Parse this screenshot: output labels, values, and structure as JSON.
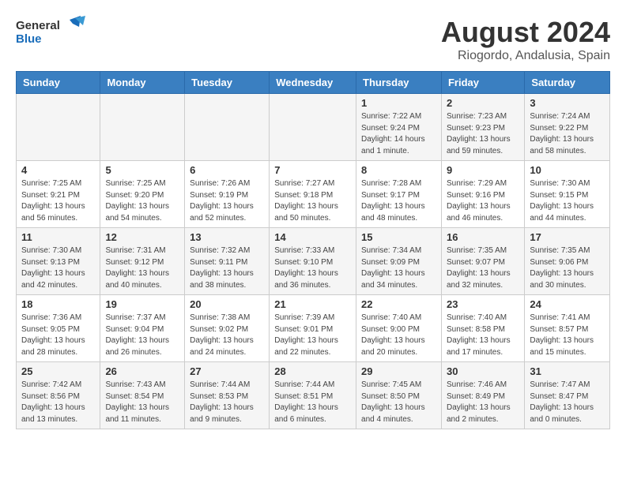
{
  "header": {
    "logo_general": "General",
    "logo_blue": "Blue",
    "title": "August 2024",
    "subtitle": "Riogordo, Andalusia, Spain"
  },
  "days_of_week": [
    "Sunday",
    "Monday",
    "Tuesday",
    "Wednesday",
    "Thursday",
    "Friday",
    "Saturday"
  ],
  "weeks": [
    [
      {
        "day": "",
        "info": ""
      },
      {
        "day": "",
        "info": ""
      },
      {
        "day": "",
        "info": ""
      },
      {
        "day": "",
        "info": ""
      },
      {
        "day": "1",
        "info": "Sunrise: 7:22 AM\nSunset: 9:24 PM\nDaylight: 14 hours\nand 1 minute."
      },
      {
        "day": "2",
        "info": "Sunrise: 7:23 AM\nSunset: 9:23 PM\nDaylight: 13 hours\nand 59 minutes."
      },
      {
        "day": "3",
        "info": "Sunrise: 7:24 AM\nSunset: 9:22 PM\nDaylight: 13 hours\nand 58 minutes."
      }
    ],
    [
      {
        "day": "4",
        "info": "Sunrise: 7:25 AM\nSunset: 9:21 PM\nDaylight: 13 hours\nand 56 minutes."
      },
      {
        "day": "5",
        "info": "Sunrise: 7:25 AM\nSunset: 9:20 PM\nDaylight: 13 hours\nand 54 minutes."
      },
      {
        "day": "6",
        "info": "Sunrise: 7:26 AM\nSunset: 9:19 PM\nDaylight: 13 hours\nand 52 minutes."
      },
      {
        "day": "7",
        "info": "Sunrise: 7:27 AM\nSunset: 9:18 PM\nDaylight: 13 hours\nand 50 minutes."
      },
      {
        "day": "8",
        "info": "Sunrise: 7:28 AM\nSunset: 9:17 PM\nDaylight: 13 hours\nand 48 minutes."
      },
      {
        "day": "9",
        "info": "Sunrise: 7:29 AM\nSunset: 9:16 PM\nDaylight: 13 hours\nand 46 minutes."
      },
      {
        "day": "10",
        "info": "Sunrise: 7:30 AM\nSunset: 9:15 PM\nDaylight: 13 hours\nand 44 minutes."
      }
    ],
    [
      {
        "day": "11",
        "info": "Sunrise: 7:30 AM\nSunset: 9:13 PM\nDaylight: 13 hours\nand 42 minutes."
      },
      {
        "day": "12",
        "info": "Sunrise: 7:31 AM\nSunset: 9:12 PM\nDaylight: 13 hours\nand 40 minutes."
      },
      {
        "day": "13",
        "info": "Sunrise: 7:32 AM\nSunset: 9:11 PM\nDaylight: 13 hours\nand 38 minutes."
      },
      {
        "day": "14",
        "info": "Sunrise: 7:33 AM\nSunset: 9:10 PM\nDaylight: 13 hours\nand 36 minutes."
      },
      {
        "day": "15",
        "info": "Sunrise: 7:34 AM\nSunset: 9:09 PM\nDaylight: 13 hours\nand 34 minutes."
      },
      {
        "day": "16",
        "info": "Sunrise: 7:35 AM\nSunset: 9:07 PM\nDaylight: 13 hours\nand 32 minutes."
      },
      {
        "day": "17",
        "info": "Sunrise: 7:35 AM\nSunset: 9:06 PM\nDaylight: 13 hours\nand 30 minutes."
      }
    ],
    [
      {
        "day": "18",
        "info": "Sunrise: 7:36 AM\nSunset: 9:05 PM\nDaylight: 13 hours\nand 28 minutes."
      },
      {
        "day": "19",
        "info": "Sunrise: 7:37 AM\nSunset: 9:04 PM\nDaylight: 13 hours\nand 26 minutes."
      },
      {
        "day": "20",
        "info": "Sunrise: 7:38 AM\nSunset: 9:02 PM\nDaylight: 13 hours\nand 24 minutes."
      },
      {
        "day": "21",
        "info": "Sunrise: 7:39 AM\nSunset: 9:01 PM\nDaylight: 13 hours\nand 22 minutes."
      },
      {
        "day": "22",
        "info": "Sunrise: 7:40 AM\nSunset: 9:00 PM\nDaylight: 13 hours\nand 20 minutes."
      },
      {
        "day": "23",
        "info": "Sunrise: 7:40 AM\nSunset: 8:58 PM\nDaylight: 13 hours\nand 17 minutes."
      },
      {
        "day": "24",
        "info": "Sunrise: 7:41 AM\nSunset: 8:57 PM\nDaylight: 13 hours\nand 15 minutes."
      }
    ],
    [
      {
        "day": "25",
        "info": "Sunrise: 7:42 AM\nSunset: 8:56 PM\nDaylight: 13 hours\nand 13 minutes."
      },
      {
        "day": "26",
        "info": "Sunrise: 7:43 AM\nSunset: 8:54 PM\nDaylight: 13 hours\nand 11 minutes."
      },
      {
        "day": "27",
        "info": "Sunrise: 7:44 AM\nSunset: 8:53 PM\nDaylight: 13 hours\nand 9 minutes."
      },
      {
        "day": "28",
        "info": "Sunrise: 7:44 AM\nSunset: 8:51 PM\nDaylight: 13 hours\nand 6 minutes."
      },
      {
        "day": "29",
        "info": "Sunrise: 7:45 AM\nSunset: 8:50 PM\nDaylight: 13 hours\nand 4 minutes."
      },
      {
        "day": "30",
        "info": "Sunrise: 7:46 AM\nSunset: 8:49 PM\nDaylight: 13 hours\nand 2 minutes."
      },
      {
        "day": "31",
        "info": "Sunrise: 7:47 AM\nSunset: 8:47 PM\nDaylight: 13 hours\nand 0 minutes."
      }
    ]
  ]
}
